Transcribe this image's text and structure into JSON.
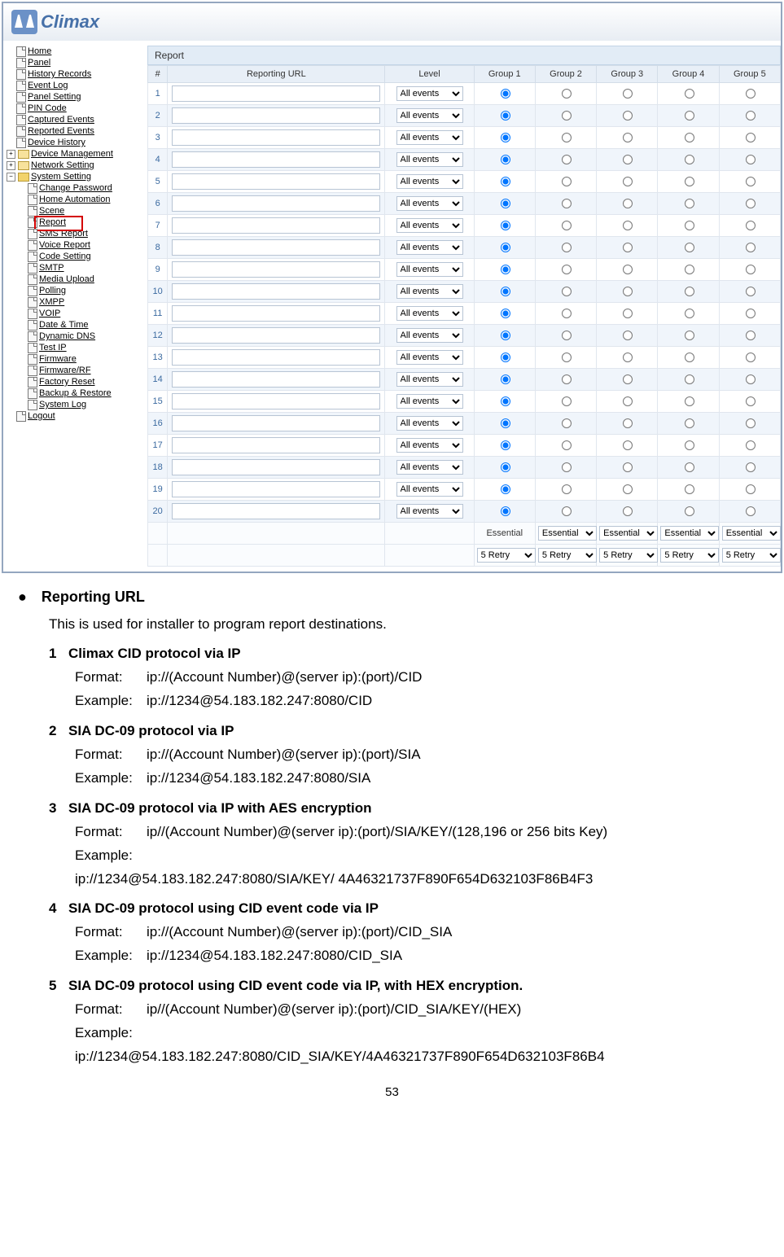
{
  "logo_text": "Climax",
  "sidebar": {
    "items": [
      {
        "label": "Home",
        "lvl": 1
      },
      {
        "label": "Panel",
        "lvl": 1
      },
      {
        "label": "History Records",
        "lvl": 1
      },
      {
        "label": "Event Log",
        "lvl": 1
      },
      {
        "label": "Panel Setting",
        "lvl": 1
      },
      {
        "label": "PIN Code",
        "lvl": 1
      },
      {
        "label": "Captured Events",
        "lvl": 1
      },
      {
        "label": "Reported Events",
        "lvl": 1
      },
      {
        "label": "Device History",
        "lvl": 1
      },
      {
        "label": "Device Management",
        "lvl": 1,
        "folder": true,
        "exp": "+"
      },
      {
        "label": "Network Setting",
        "lvl": 1,
        "folder": true,
        "exp": "+"
      },
      {
        "label": "System Setting",
        "lvl": 1,
        "folder": true,
        "open": true,
        "exp": "−"
      },
      {
        "label": "Change Password",
        "lvl": 2
      },
      {
        "label": "Home Automation",
        "lvl": 2
      },
      {
        "label": "Scene",
        "lvl": 2
      },
      {
        "label": "Report",
        "lvl": 2,
        "highlight": true
      },
      {
        "label": "SMS Report",
        "lvl": 2
      },
      {
        "label": "Voice Report",
        "lvl": 2
      },
      {
        "label": "Code Setting",
        "lvl": 2
      },
      {
        "label": "SMTP",
        "lvl": 2
      },
      {
        "label": "Media Upload",
        "lvl": 2
      },
      {
        "label": "Polling",
        "lvl": 2
      },
      {
        "label": "XMPP",
        "lvl": 2
      },
      {
        "label": "VOIP",
        "lvl": 2
      },
      {
        "label": "Date & Time",
        "lvl": 2
      },
      {
        "label": "Dynamic DNS",
        "lvl": 2
      },
      {
        "label": "Test IP",
        "lvl": 2
      },
      {
        "label": "Firmware",
        "lvl": 2
      },
      {
        "label": "Firmware/RF",
        "lvl": 2
      },
      {
        "label": "Factory Reset",
        "lvl": 2
      },
      {
        "label": "Backup & Restore",
        "lvl": 2
      },
      {
        "label": "System Log",
        "lvl": 2
      },
      {
        "label": "Logout",
        "lvl": 1
      }
    ]
  },
  "report": {
    "panel_title": "Report",
    "headers": {
      "num": "#",
      "url": "Reporting URL",
      "level": "Level",
      "g1": "Group 1",
      "g2": "Group 2",
      "g3": "Group 3",
      "g4": "Group 4",
      "g5": "Group 5"
    },
    "level_option": "All events",
    "row_count": 20,
    "footer": {
      "essential_label": "Essential",
      "essential_select": "Essential",
      "retry_select": "5 Retry"
    }
  },
  "doc": {
    "heading": "Reporting URL",
    "intro": "This is used for installer to program report destinations.",
    "protocols": [
      {
        "n": "1",
        "title": "Climax CID protocol via IP",
        "fmt_label": "Format:",
        "fmt": "ip://(Account Number)@(server ip):(port)/CID",
        "ex_label": "Example:",
        "ex": "ip://1234@54.183.182.247:8080/CID"
      },
      {
        "n": "2",
        "title": "SIA DC-09 protocol via IP",
        "fmt_label": "Format:",
        "fmt": "ip://(Account Number)@(server ip):(port)/SIA",
        "ex_label": "Example:",
        "ex": "ip://1234@54.183.182.247:8080/SIA"
      },
      {
        "n": "3",
        "title": "SIA DC-09 protocol via IP with AES encryption",
        "fmt_label": "Format:",
        "fmt": "ip//(Account Number)@(server ip):(port)/SIA/KEY/(128,196 or 256 bits Key)",
        "ex_label": "Example:",
        "ex": "ip://1234@54.183.182.247:8080/SIA/KEY/ 4A46321737F890F654D632103F86B4F3"
      },
      {
        "n": "4",
        "title": "SIA DC-09 protocol using CID event code via IP",
        "fmt_label": "Format:",
        "fmt": "ip://(Account Number)@(server ip):(port)/CID_SIA",
        "ex_label": "Example:",
        "ex": "ip://1234@54.183.182.247:8080/CID_SIA"
      },
      {
        "n": "5",
        "title": "SIA DC-09 protocol using CID event code via IP, with HEX encryption.",
        "fmt_label": "Format:",
        "fmt": "ip//(Account Number)@(server ip):(port)/CID_SIA/KEY/(HEX)",
        "ex_label": "Example:",
        "ex": "ip://1234@54.183.182.247:8080/CID_SIA/KEY/4A46321737F890F654D632103F86B4"
      }
    ],
    "page_num": "53"
  }
}
